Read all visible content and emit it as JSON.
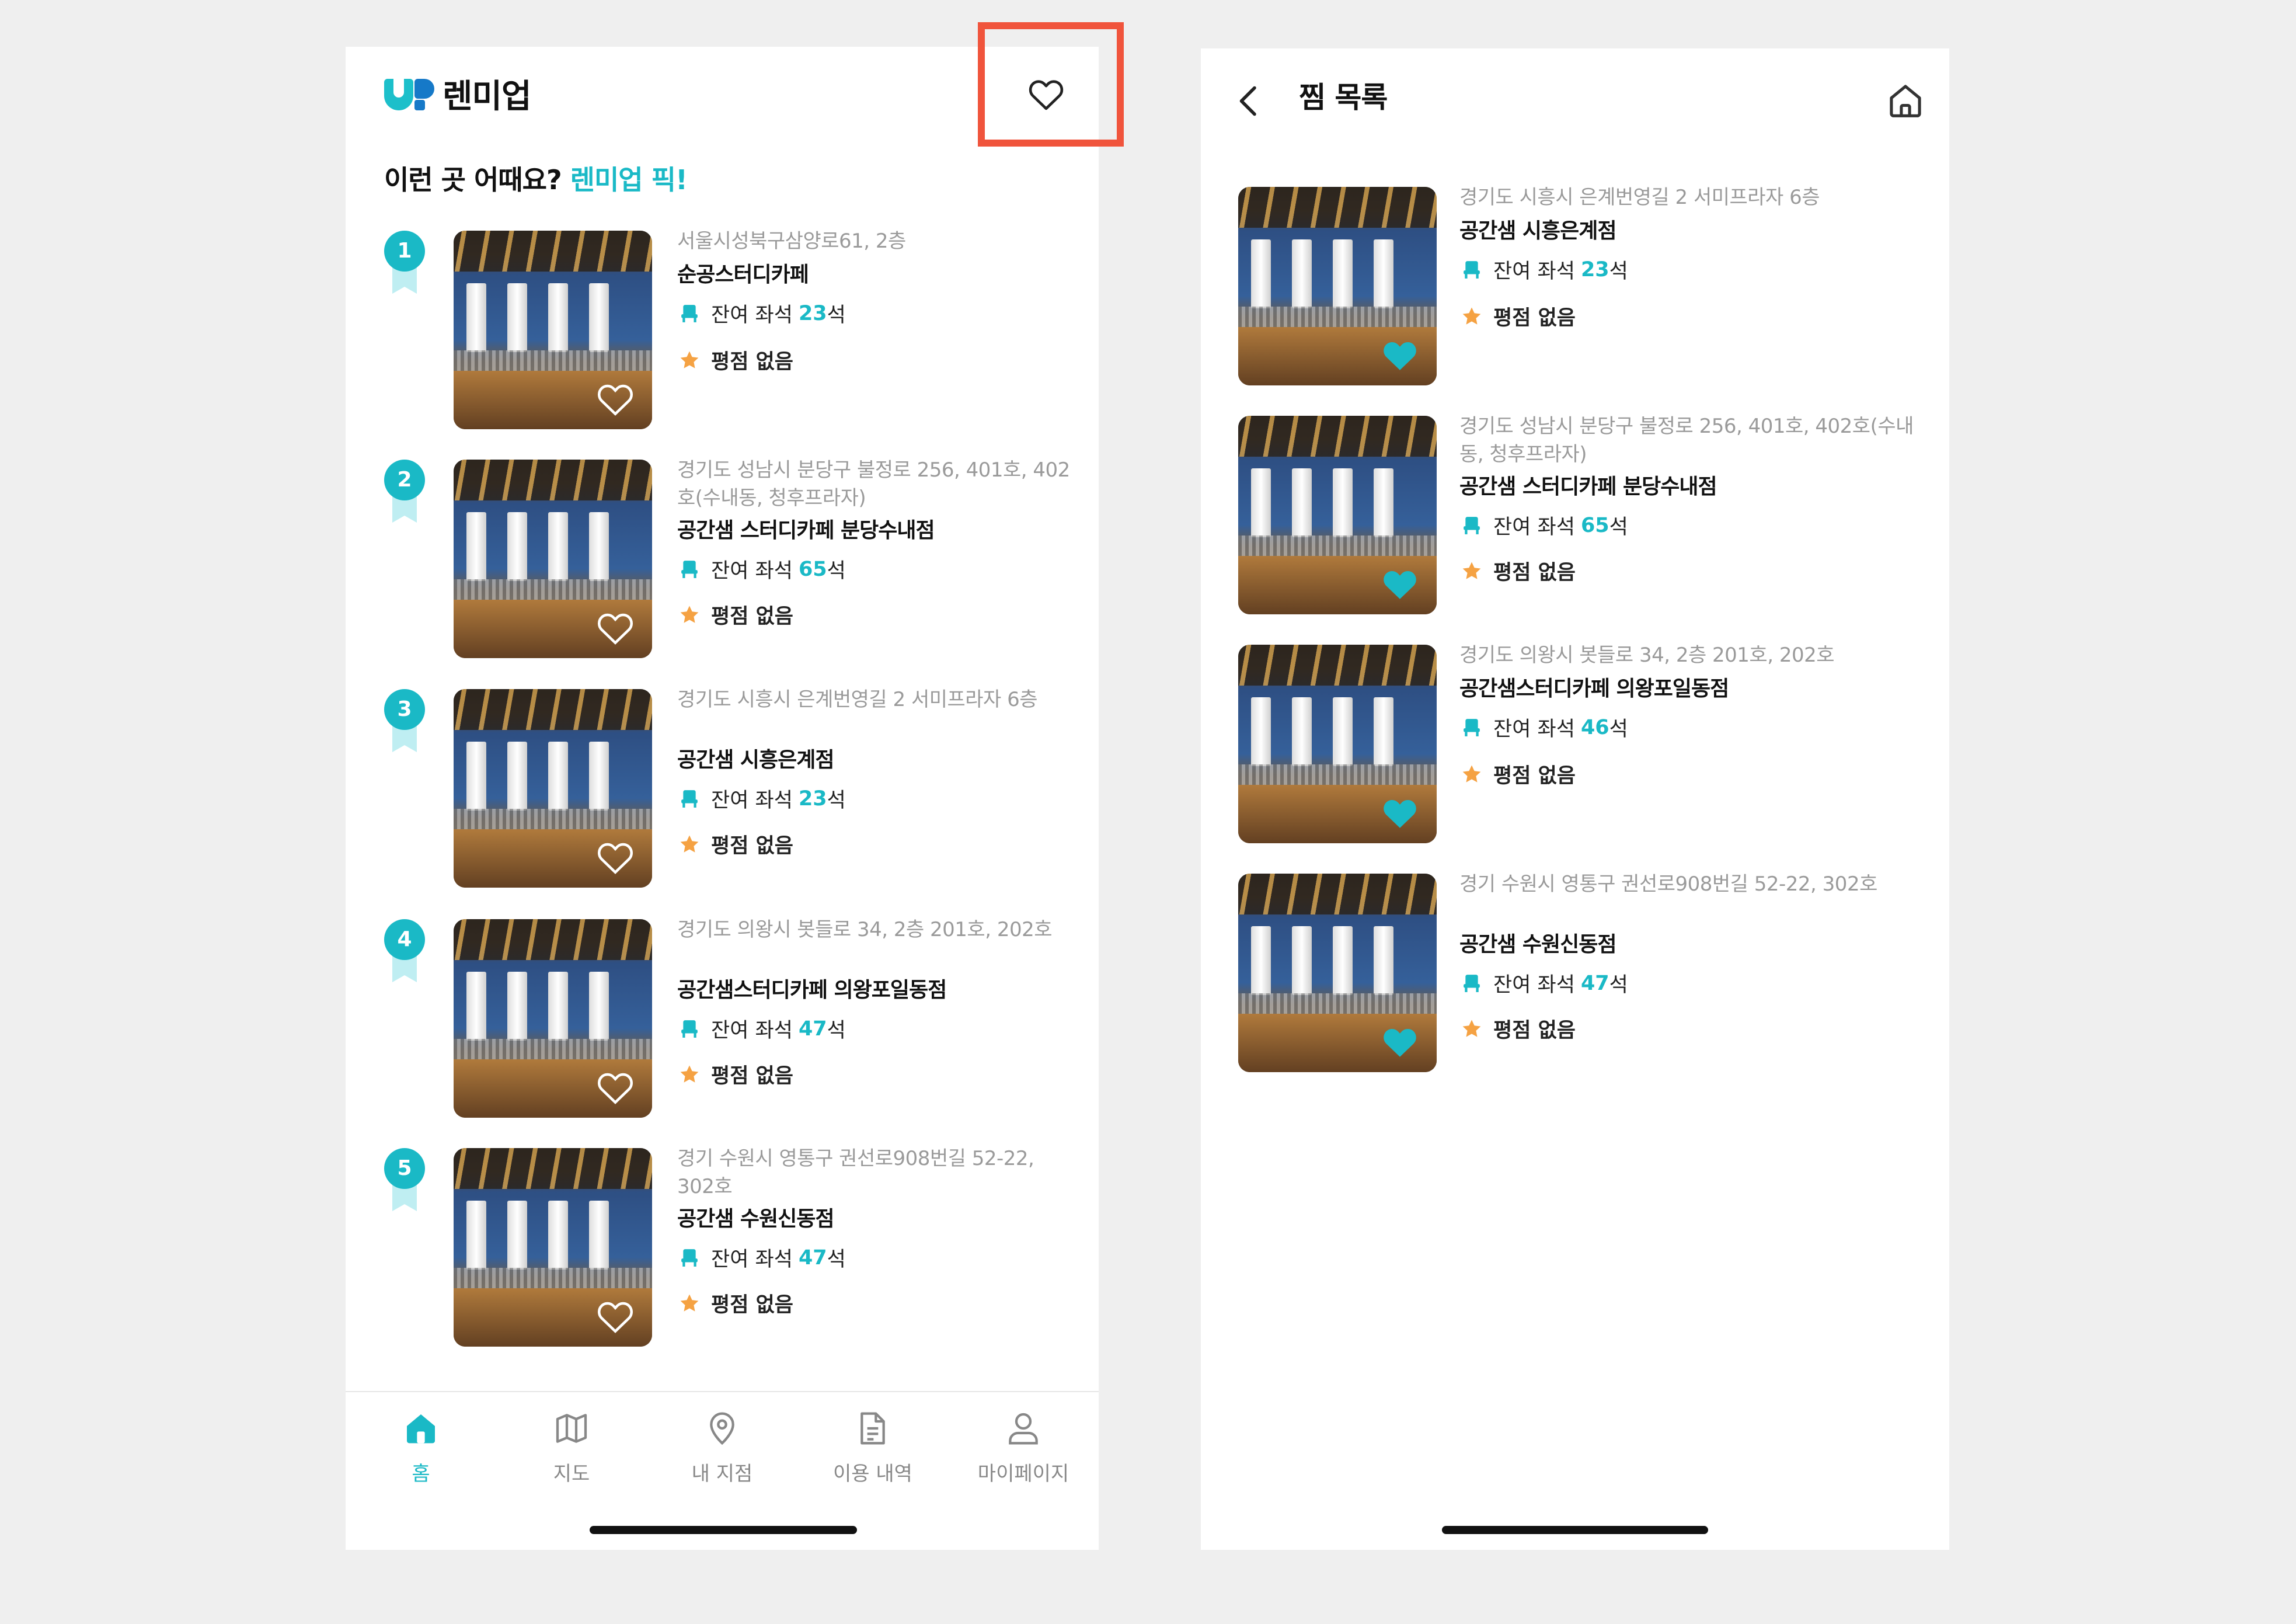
{
  "left_screen": {
    "brand": {
      "name": "렌미업"
    },
    "section_title": {
      "prefix": "이런 곳 어때요?",
      "accent": "렌미업 픽!"
    },
    "items": [
      {
        "rank": "1",
        "address": "서울시성북구삼양로61, 2층",
        "name": "순공스터디카페",
        "seat_label": "잔여 좌석",
        "seat_count": "23",
        "seat_unit": "석",
        "rating": "평점 없음"
      },
      {
        "rank": "2",
        "address": "경기도 성남시 분당구 불정로 256, 401호, 402호(수내동, 청후프라자)",
        "name": "공간샘 스터디카페 분당수내점",
        "seat_label": "잔여 좌석",
        "seat_count": "65",
        "seat_unit": "석",
        "rating": "평점 없음"
      },
      {
        "rank": "3",
        "address": "경기도 시흥시 은계번영길 2 서미프라자 6층",
        "name": "공간샘 시흥은계점",
        "seat_label": "잔여 좌석",
        "seat_count": "23",
        "seat_unit": "석",
        "rating": "평점 없음"
      },
      {
        "rank": "4",
        "address": "경기도 의왕시 봇들로 34, 2층 201호, 202호",
        "name": "공간샘스터디카페 의왕포일동점",
        "seat_label": "잔여 좌석",
        "seat_count": "47",
        "seat_unit": "석",
        "rating": "평점 없음"
      },
      {
        "rank": "5",
        "address": "경기 수원시 영통구 권선로908번길 52-22, 302호",
        "name": "공간샘 수원신동점",
        "seat_label": "잔여 좌석",
        "seat_count": "47",
        "seat_unit": "석",
        "rating": "평점 없음"
      }
    ],
    "tabs": [
      {
        "label": "홈",
        "icon": "home-icon",
        "active": true
      },
      {
        "label": "지도",
        "icon": "map-icon",
        "active": false
      },
      {
        "label": "내 지점",
        "icon": "location-pin-icon",
        "active": false
      },
      {
        "label": "이용 내역",
        "icon": "document-icon",
        "active": false
      },
      {
        "label": "마이페이지",
        "icon": "person-icon",
        "active": false
      }
    ]
  },
  "right_screen": {
    "title": "찜 목록",
    "items": [
      {
        "address": "경기도 시흥시 은계번영길 2 서미프라자 6층",
        "name": "공간샘 시흥은계점",
        "seat_label": "잔여 좌석",
        "seat_count": "23",
        "seat_unit": "석",
        "rating": "평점 없음"
      },
      {
        "address": "경기도 성남시 분당구 불정로 256, 401호, 402호(수내동, 청후프라자)",
        "name": "공간샘 스터디카페 분당수내점",
        "seat_label": "잔여 좌석",
        "seat_count": "65",
        "seat_unit": "석",
        "rating": "평점 없음"
      },
      {
        "address": "경기도 의왕시 봇들로 34, 2층 201호, 202호",
        "name": "공간샘스터디카페 의왕포일동점",
        "seat_label": "잔여 좌석",
        "seat_count": "46",
        "seat_unit": "석",
        "rating": "평점 없음"
      },
      {
        "address": "경기 수원시 영통구 권선로908번길 52-22, 302호",
        "name": "공간샘 수원신동점",
        "seat_label": "잔여 좌석",
        "seat_count": "47",
        "seat_unit": "석",
        "rating": "평점 없음"
      }
    ]
  },
  "colors": {
    "accent": "#1ab9c6",
    "brand_blue": "#1679c8",
    "star": "#f5a243",
    "callout": "#f0543c"
  }
}
